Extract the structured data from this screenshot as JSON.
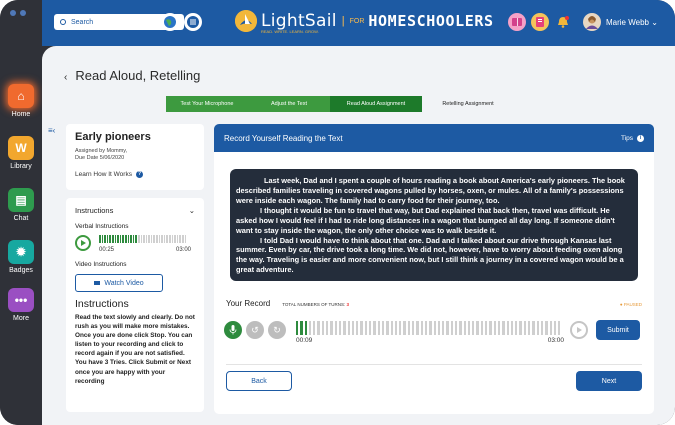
{
  "sidebar": {
    "items": [
      {
        "label": "Home",
        "icon": "home-icon",
        "color": "#f06a2e",
        "glyph": "⌂"
      },
      {
        "label": "Library",
        "icon": "library-icon",
        "color": "#f2a72e",
        "glyph": "W"
      },
      {
        "label": "Chat",
        "icon": "chat-icon",
        "color": "#2e9b4e",
        "glyph": "▤"
      },
      {
        "label": "Badges",
        "icon": "badge-icon",
        "color": "#17a8a0",
        "glyph": "✹"
      },
      {
        "label": "More",
        "icon": "more-icon",
        "color": "#9a4fc2",
        "glyph": "•••"
      }
    ]
  },
  "topbar": {
    "search_placeholder": "Search",
    "brand_name": "LightSail",
    "brand_tagline": "READ. WRITE. LEARN. GROW.",
    "brand_separator": "|",
    "brand_for": "FOR",
    "brand_product": "HOMESCHOOLERS",
    "user_name": "Marie Webb ⌄",
    "accent": "#1d5aa3"
  },
  "page": {
    "back_glyph": "‹",
    "title": "Read Aloud, Retelling"
  },
  "stepper": {
    "steps": [
      {
        "label": "Test Your Microphone",
        "state": "done"
      },
      {
        "label": "Adjust the Text",
        "state": "done"
      },
      {
        "label": "Read Aloud Assignment",
        "state": "current"
      },
      {
        "label": "Retelling Assignment",
        "state": "todo"
      }
    ]
  },
  "assignment": {
    "title": "Early pioneers",
    "assigned_by": "Assigned by Mommy,",
    "due_date": "Due Date 5/06/2020",
    "learn_link": "Learn How It Works"
  },
  "instructions": {
    "header": "Instructions",
    "verbal_label": "Verbal Instructions",
    "verbal_progress": 0.45,
    "verbal_time_current": "00:25",
    "verbal_time_total": "03:00",
    "video_label": "Video Instructions",
    "watch_button": "Watch Video",
    "title": "Instructions",
    "body": "Read the text slowly and clearly. Do not rush as you will make more mistakes. Once you are done click Stop. You can listen to your recording and click to record again if you are not satisfied. You have 3 Tries. Click Submit or Next once you are happy with your recording"
  },
  "recorder": {
    "header": "Record Yourself Reading the Text",
    "tips": "Tips",
    "passage": [
      "Last week, Dad and I spent a couple of hours reading a book about America's early pioneers. The book described families traveling in covered wagons pulled by horses, oxen, or mules. All of a family's possessions were inside each wagon. The family had to carry food for their journey, too.",
      "I thought it would be fun to travel that way, but Dad explained that back then, travel was difficult. He asked how I would feel if I had to ride long distances in a wagon that bumped all day long. If someone didn't want to stay inside the wagon, the only other choice was to walk beside it.",
      "I told Dad I would have to think about that one. Dad and I talked about our drive through Kansas last summer. Even by car, the drive took a long time. We did not, however, have to worry about feeding oxen along the way. Traveling is easier and more convenient now, but I still think a journey in a covered wagon would be a great adventure."
    ],
    "your_record": "Your Record",
    "turns_label": "TOTAL NUMBERS OF TURNS:",
    "turns_value": "3",
    "status": "● PAUSED",
    "progress": 0.05,
    "time_current": "00:09",
    "time_total": "03:00",
    "submit": "Submit",
    "back": "Back",
    "next": "Next"
  }
}
